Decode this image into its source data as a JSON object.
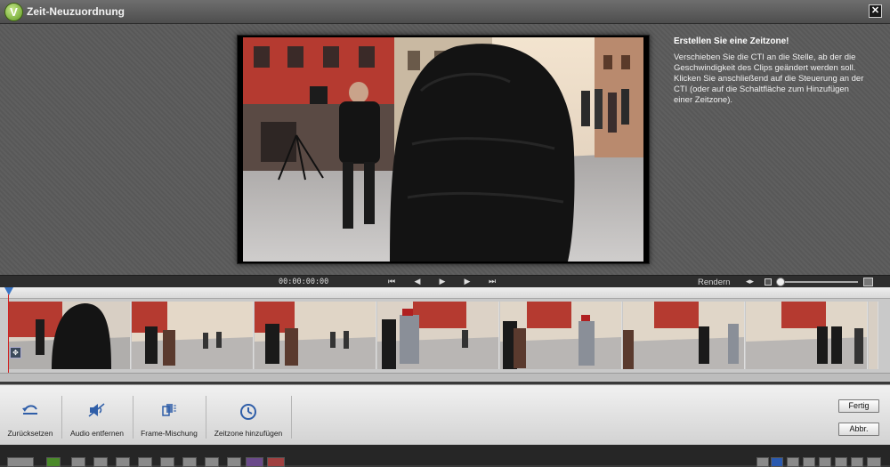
{
  "window": {
    "title": "Zeit-Neuzuordnung",
    "close_glyph": "✕"
  },
  "instructions": {
    "title": "Erstellen Sie eine Zeitzone!",
    "body": "Verschieben Sie die CTI an die Stelle, ab der die Geschwindigkeit des Clips geändert werden soll. Klicken Sie anschließend auf die Steuerung an der CTI (oder auf die Schaltfläche zum Hinzufügen einer Zeitzone)."
  },
  "transport": {
    "timecode": "00:00:00:00",
    "render_label": "Rendern",
    "buttons": [
      "go-to-start",
      "step-back",
      "play",
      "step-forward",
      "go-to-end"
    ]
  },
  "toolbar": {
    "reset_label": "Zurücksetzen",
    "remove_audio_label": "Audio entfernen",
    "frame_blend_label": "Frame-Mischung",
    "add_timezone_label": "Zeitzone hinzufügen",
    "done_label": "Fertig",
    "cancel_label": "Abbr."
  },
  "colors": {
    "accent_blue": "#3a75c4",
    "cti_red": "#d02020",
    "logo_green": "#5f9a21"
  },
  "icons": [
    "app-logo-icon",
    "close-icon",
    "reset-icon",
    "audio-remove-icon",
    "frame-blend-icon",
    "timezone-add-icon"
  ]
}
